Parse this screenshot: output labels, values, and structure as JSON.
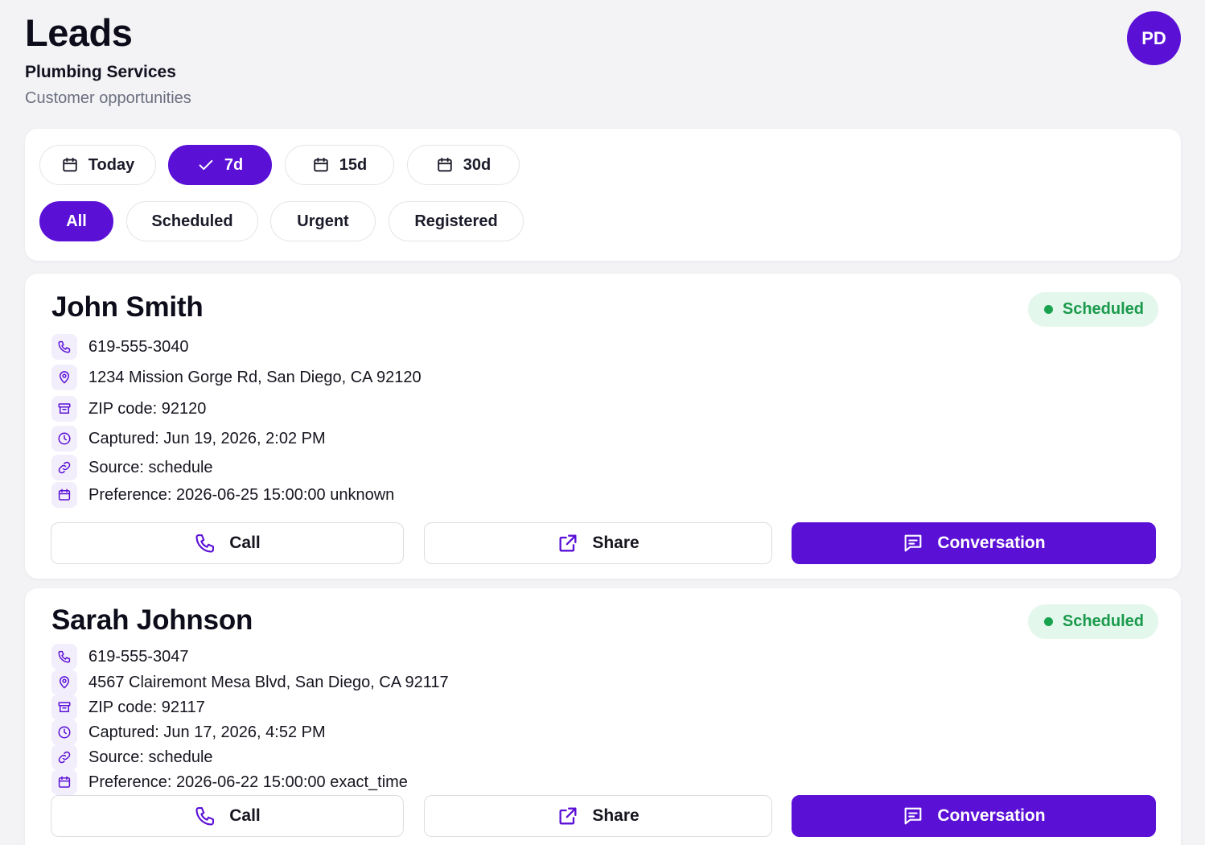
{
  "header": {
    "title": "Leads",
    "business": "Plumbing Services",
    "subtitle": "Customer opportunities",
    "avatar_initials": "PD"
  },
  "date_filters": [
    {
      "label": "Today",
      "icon": "calendar-icon",
      "active": false
    },
    {
      "label": "7d",
      "icon": "check-icon",
      "active": true
    },
    {
      "label": "15d",
      "icon": "calendar-icon",
      "active": false
    },
    {
      "label": "30d",
      "icon": "calendar-icon",
      "active": false
    }
  ],
  "status_filters": [
    {
      "label": "All",
      "active": true
    },
    {
      "label": "Scheduled",
      "active": false
    },
    {
      "label": "Urgent",
      "active": false
    },
    {
      "label": "Registered",
      "active": false
    }
  ],
  "leads": [
    {
      "name": "John Smith",
      "status": "Scheduled",
      "phone": "619-555-3040",
      "address": "1234 Mission Gorge Rd, San Diego, CA 92120",
      "zip": "ZIP code: 92120",
      "captured": "Captured: Jun 19, 2026, 2:02 PM",
      "source": "Source: schedule",
      "preference": "Preference: 2026-06-25 15:00:00 unknown"
    },
    {
      "name": "Sarah Johnson",
      "status": "Scheduled",
      "phone": "619-555-3047",
      "address": "4567 Clairemont Mesa Blvd, San Diego, CA 92117",
      "zip": "ZIP code: 92117",
      "captured": "Captured: Jun 17, 2026, 4:52 PM",
      "source": "Source: schedule",
      "preference": "Preference: 2026-06-22 15:00:00 exact_time"
    }
  ],
  "actions": {
    "call_label": "Call",
    "share_label": "Share",
    "conversation_label": "Conversation"
  },
  "colors": {
    "accent": "#5b10d6",
    "badge_bg": "#e3f7ec",
    "badge_text": "#1a9a4c",
    "background": "#f3f3f6"
  }
}
